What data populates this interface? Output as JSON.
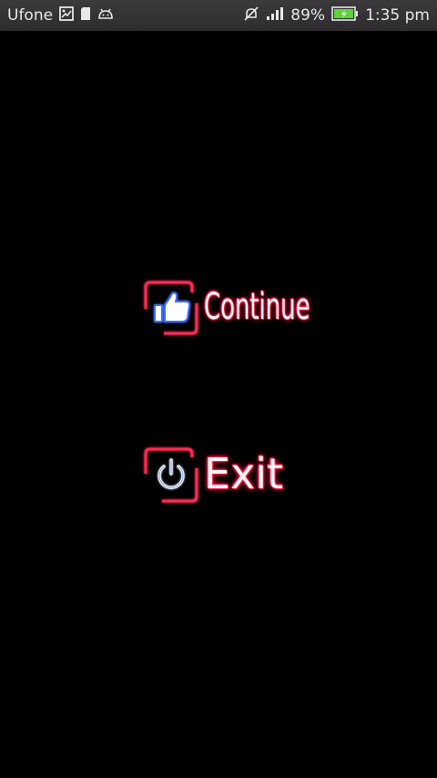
{
  "status_bar": {
    "carrier": "Ufone",
    "battery_percent": "89%",
    "time": "1:35 pm",
    "icons": [
      "gallery-icon",
      "sd-card-icon",
      "android-debug-icon",
      "mute-icon",
      "signal-icon",
      "battery-charging-icon"
    ]
  },
  "menu": {
    "continue_label": "Continue",
    "continue_icon": "thumbs-up-icon",
    "exit_label": "Exit",
    "exit_icon": "power-icon"
  },
  "colors": {
    "background": "#000000",
    "neon_red": "#ff2a55",
    "neon_blue": "#3a6cff",
    "status_bar": "#343234"
  }
}
